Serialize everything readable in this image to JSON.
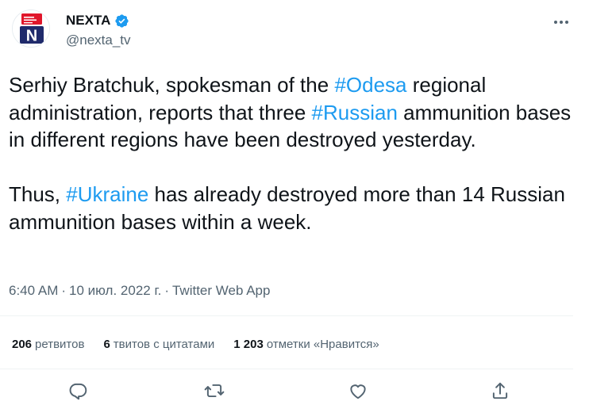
{
  "account": {
    "name": "NEXTA",
    "handle": "@nexta_tv",
    "avatar_letter": "N"
  },
  "tweet": {
    "paragraph1": [
      {
        "text": "Serhiy Bratchuk, spokesman of the ",
        "hashtag": false
      },
      {
        "text": "#Odesa",
        "hashtag": true
      },
      {
        "text": " regional administration, reports that three ",
        "hashtag": false
      },
      {
        "text": "#Russian",
        "hashtag": true
      },
      {
        "text": " ammunition bases in different regions have been destroyed yesterday.",
        "hashtag": false
      }
    ],
    "paragraph2": [
      {
        "text": "Thus, ",
        "hashtag": false
      },
      {
        "text": "#Ukraine",
        "hashtag": true
      },
      {
        "text": " has already destroyed more than 14 Russian ammunition bases within a week.",
        "hashtag": false
      }
    ]
  },
  "meta": {
    "time": "6:40 AM",
    "separator": "·",
    "date": "10 июл. 2022 г.",
    "app": "Twitter Web App"
  },
  "stats": {
    "retweets_count": "206",
    "retweets_label": "ретвитов",
    "quotes_count": "6",
    "quotes_label": "твитов с цитатами",
    "likes_count": "1 203",
    "likes_label": "отметки «Нравится»"
  },
  "colors": {
    "hashtag": "#1d9bf0",
    "text": "#0f1419",
    "secondary": "#536471",
    "brand_red": "#e0162b",
    "brand_navy": "#1f2a6b"
  },
  "icons": [
    "verified-badge-icon",
    "more-options-icon",
    "reply-icon",
    "retweet-icon",
    "like-icon",
    "share-icon"
  ]
}
